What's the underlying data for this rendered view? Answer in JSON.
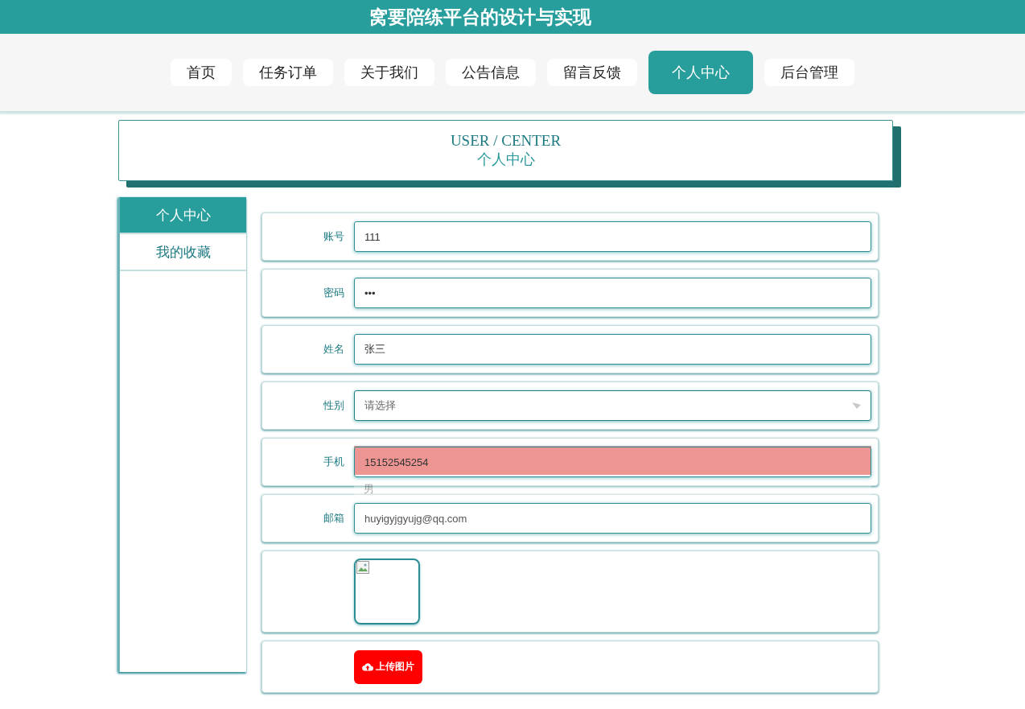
{
  "header": {
    "title": "窝要陪练平台的设计与实现"
  },
  "nav": [
    {
      "label": "首页",
      "selected": false
    },
    {
      "label": "任务订单",
      "selected": false
    },
    {
      "label": "关于我们",
      "selected": false
    },
    {
      "label": "公告信息",
      "selected": false
    },
    {
      "label": "留言反馈",
      "selected": false
    },
    {
      "label": "个人中心",
      "selected": true
    },
    {
      "label": "后台管理",
      "selected": false
    }
  ],
  "page_banner": {
    "title_en": "USER / CENTER",
    "title": "个人中心"
  },
  "sidebar": {
    "items": [
      {
        "label": "个人中心",
        "selected": true
      },
      {
        "label": "我的收藏",
        "selected": false
      }
    ]
  },
  "form": {
    "fields": [
      {
        "kind": "text",
        "label": "账号",
        "value": "111"
      },
      {
        "kind": "password",
        "label": "密码",
        "value": "•••"
      },
      {
        "kind": "text",
        "label": "姓名",
        "value": "张三"
      },
      {
        "kind": "select",
        "label": "性别",
        "placeholder": "请选择",
        "expanded": true,
        "options": [
          {
            "selected": true
          },
          {
            "label": "男",
            "selected": false
          }
        ]
      },
      {
        "kind": "text",
        "label": "手机",
        "value": "15152545254"
      },
      {
        "kind": "text",
        "label": "邮箱",
        "value": "huyigyjgyujg@qq.com"
      },
      {
        "kind": "image"
      },
      {
        "kind": "upload",
        "button": "上传图片"
      }
    ]
  }
}
